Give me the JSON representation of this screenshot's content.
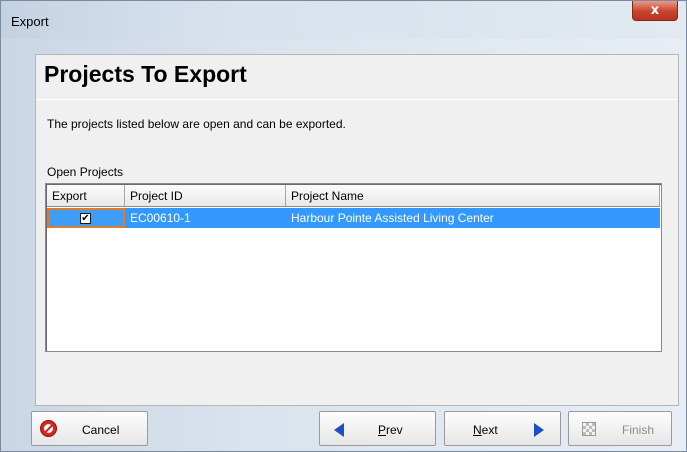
{
  "window": {
    "title": "Export",
    "close_symbol": "x"
  },
  "page": {
    "title": "Projects To Export",
    "description": "The projects listed below are open and can be exported.",
    "open_projects_label": "Open Projects"
  },
  "table": {
    "columns": [
      "Export",
      "Project ID",
      "Project Name"
    ],
    "rows": [
      {
        "export": true,
        "project_id": "EC00610-1",
        "project_name": "Harbour Pointe Assisted Living Center"
      }
    ]
  },
  "buttons": {
    "cancel": "Cancel",
    "prev_mnemonic": "P",
    "prev_rest": "rev",
    "next_mnemonic": "N",
    "next_rest": "ext",
    "finish": "Finish"
  },
  "icons": {
    "close": "close-icon",
    "cancel": "cancel-icon",
    "prev": "arrow-left-icon",
    "next": "arrow-right-icon",
    "finish": "checkered-flag-icon",
    "checkbox": "checkbox-checked-icon"
  },
  "colors": {
    "selection": "#3399ff",
    "focus_border": "#e07b2a",
    "arrow": "#1f4fc4",
    "cancel_icon": "#d7261b"
  }
}
